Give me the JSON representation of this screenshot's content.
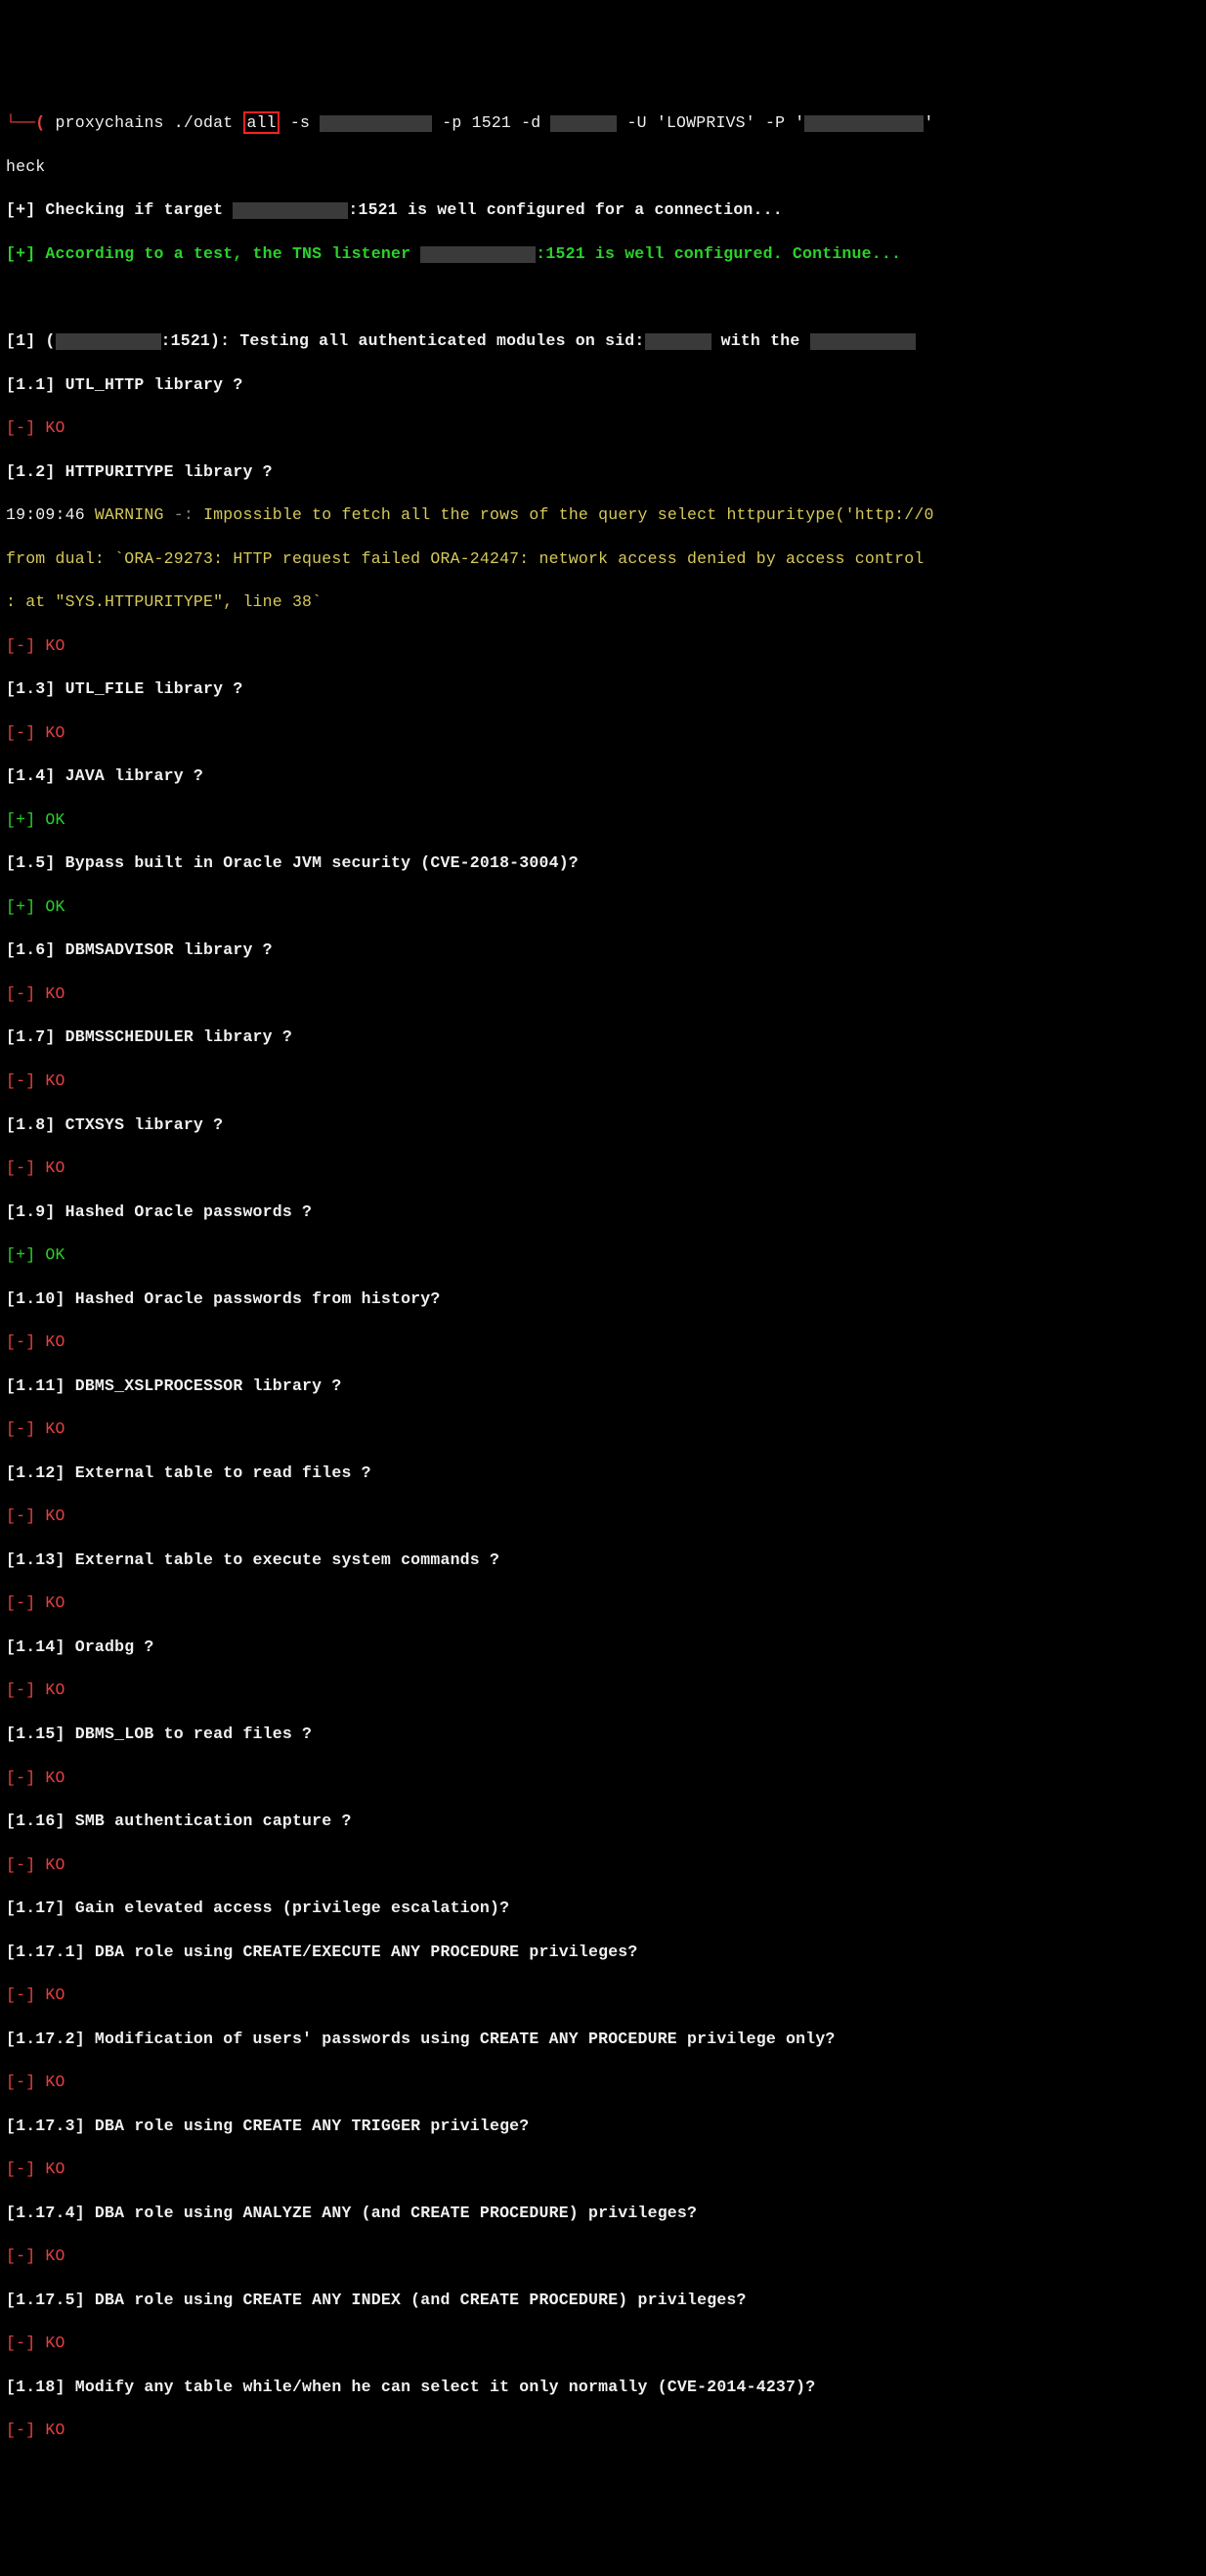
{
  "cmd": {
    "prefix": "└──(",
    "invoke": " proxychains ./odat ",
    "boxed": "all",
    "after_box": " -s ",
    "flag_p": " -p 1521 -d ",
    "flag_u": " -U 'LOWPRIVS' -P '",
    "tail": "'",
    "continuation": "heck"
  },
  "conf1": {
    "tag": "[+]",
    "a": " Checking if target ",
    "b": ":1521 is well configured for a connection..."
  },
  "conf2": {
    "tag": "[+]",
    "a": " According to a test, the TNS listener ",
    "b": ":1521 is well configured. Continue..."
  },
  "hdr": {
    "a": "[1] (",
    "b": ":1521): Testing all authenticated modules on sid:",
    "c": " with the "
  },
  "warn": {
    "ts": "19:09:46 ",
    "lvl": "WARNING",
    "dash": " -: ",
    "l1": "Impossible to fetch all the rows of the query select httpuritype('http://0",
    "l2": "from dual: `ORA-29273: HTTP request failed ORA-24247: network access denied by access control ",
    "l3": ": at \"SYS.HTTPURITYPE\", line 38`"
  },
  "ko": {
    "tag": "[-]",
    "txt": " KO"
  },
  "ok": {
    "tag": "[+]",
    "txt": " OK"
  },
  "tests": {
    "t1_1": "[1.1] UTL_HTTP library ?",
    "t1_2": "[1.2] HTTPURITYPE library ?",
    "t1_3": "[1.3] UTL_FILE library ?",
    "t1_4": "[1.4] JAVA library ?",
    "t1_5": "[1.5] Bypass built in Oracle JVM security (CVE-2018-3004)?",
    "t1_6": "[1.6] DBMSADVISOR library ?",
    "t1_7": "[1.7] DBMSSCHEDULER library ?",
    "t1_8": "[1.8] CTXSYS library ?",
    "t1_9": "[1.9] Hashed Oracle passwords ?",
    "t1_10": "[1.10] Hashed Oracle passwords from history?",
    "t1_11": "[1.11] DBMS_XSLPROCESSOR library ?",
    "t1_12": "[1.12] External table to read files ?",
    "t1_13": "[1.13] External table to execute system commands ?",
    "t1_14": "[1.14] Oradbg ?",
    "t1_15": "[1.15] DBMS_LOB to read files ?",
    "t1_16": "[1.16] SMB authentication capture ?",
    "t1_17": "[1.17] Gain elevated access (privilege escalation)?",
    "t1_17_1": "[1.17.1] DBA role using CREATE/EXECUTE ANY PROCEDURE privileges?",
    "t1_17_2": "[1.17.2] Modification of users' passwords using CREATE ANY PROCEDURE privilege only?",
    "t1_17_3": "[1.17.3] DBA role using CREATE ANY TRIGGER privilege?",
    "t1_17_4": "[1.17.4] DBA role using ANALYZE ANY (and CREATE PROCEDURE) privileges?",
    "t1_17_5": "[1.17.5] DBA role using CREATE ANY INDEX (and CREATE PROCEDURE) privileges?",
    "t1_18": "[1.18] Modify any table while/when he can select it only normally (CVE-2014-4237)?"
  }
}
